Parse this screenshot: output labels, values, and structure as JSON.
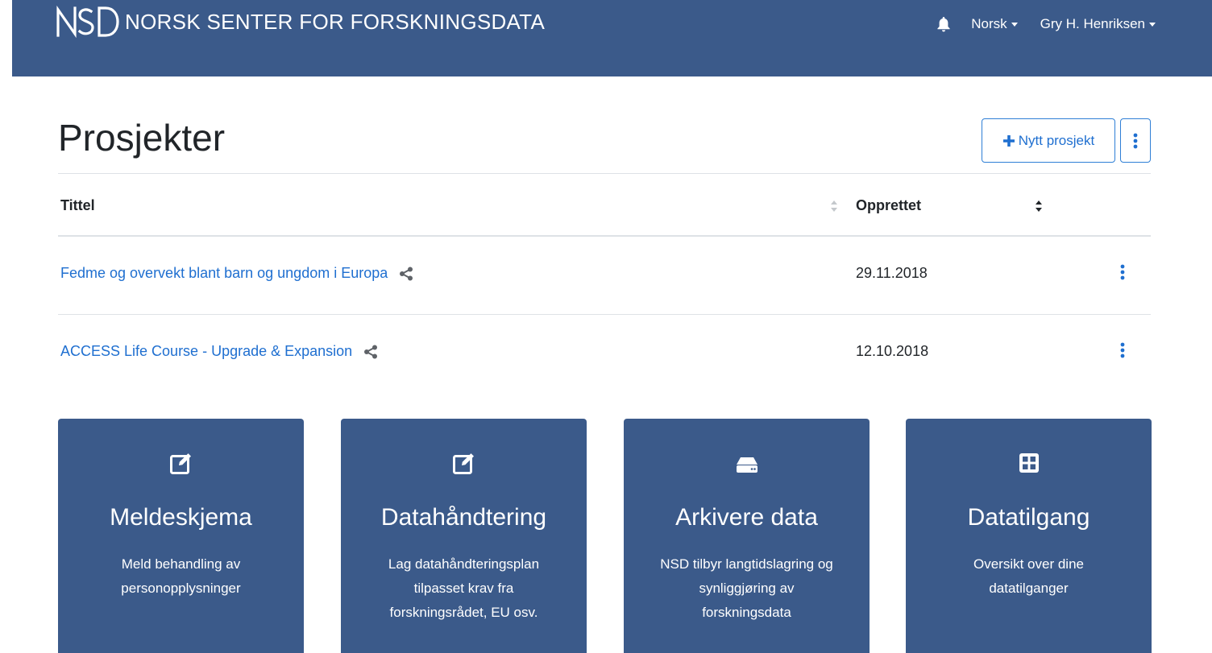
{
  "navbar": {
    "logo_text": "NSD",
    "brand": "NORSK SENTER FOR FORSKNINGSDATA",
    "bell_icon": "bell-icon",
    "language": "Norsk",
    "user": "Gry H. Henriksen"
  },
  "page": {
    "title": "Prosjekter",
    "new_project_label": "Nytt prosjekt",
    "more_icon": "vertical-ellipsis-icon"
  },
  "table": {
    "columns": [
      "Tittel",
      "Opprettet"
    ],
    "rows": [
      {
        "title": "Fedme og overvekt blant barn og ungdom i Europa",
        "created": "29.11.2018"
      },
      {
        "title": "ACCESS Life Course - Upgrade & Expansion",
        "created": "12.10.2018"
      }
    ]
  },
  "cards": [
    {
      "icon": "edit-icon",
      "title": "Meldeskjema",
      "desc_lines": [
        "Meld behandling av",
        "personopplysninger"
      ]
    },
    {
      "icon": "edit-icon",
      "title": "Datahåndtering",
      "desc_lines": [
        "Lag datahåndteringsplan",
        "tilpasset krav fra",
        "forskningsrådet, EU osv."
      ]
    },
    {
      "icon": "hard-drive-icon",
      "title": "Arkivere data",
      "desc_lines": [
        "NSD tilbyr langtidslagring og",
        "synliggjøring av",
        "forskningsdata"
      ]
    },
    {
      "icon": "table-icon",
      "title": "Datatilgang",
      "desc_lines": [
        "Oversikt over dine",
        "datatilganger"
      ]
    }
  ],
  "colors": {
    "header": "#3b5a8a",
    "link": "#1f6fd0",
    "card": "#3b5a8a"
  }
}
